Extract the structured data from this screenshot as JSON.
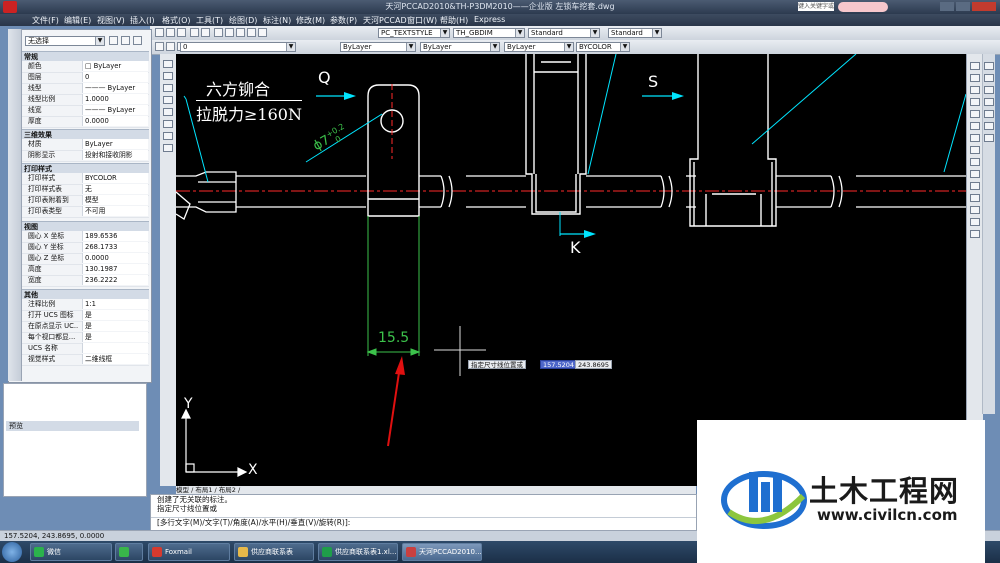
{
  "window": {
    "title": "天河PCCAD2010&TH-P3DM2010——企业版   左锁车挖套.dwg",
    "search_placeholder": "键入关键字或短语"
  },
  "menu": [
    "文件(F)",
    "编辑(E)",
    "视图(V)",
    "插入(I)",
    "格式(O)",
    "工具(T)",
    "绘图(D)",
    "标注(N)",
    "修改(M)",
    "参数(P)",
    "天河PCCAD",
    "窗口(W)",
    "帮助(H)",
    "Express"
  ],
  "toolbar": {
    "text_style": "PC_TEXTSTYLE",
    "dim_style": "TH_GBDIM",
    "table_style": "Standard",
    "multileader_style": "Standard",
    "layer": "0",
    "color": "ByLayer",
    "linetype": "ByLayer",
    "lineweight": "ByLayer",
    "plotstyle": "BYCOLOR"
  },
  "palette": {
    "selection": "无选择",
    "sections": [
      {
        "title": "常规",
        "rows": [
          [
            "颜色",
            "□ ByLayer"
          ],
          [
            "图层",
            "0"
          ],
          [
            "线型",
            "——— ByLayer"
          ],
          [
            "线型比例",
            "1.0000"
          ],
          [
            "线宽",
            "——— ByLayer"
          ],
          [
            "厚度",
            "0.0000"
          ]
        ]
      },
      {
        "title": "三维效果",
        "rows": [
          [
            "材质",
            "ByLayer"
          ],
          [
            "阴影显示",
            "投射和接收阴影"
          ]
        ]
      },
      {
        "title": "打印样式",
        "rows": [
          [
            "打印样式",
            "BYCOLOR"
          ],
          [
            "打印样式表",
            "无"
          ],
          [
            "打印表附着到",
            "模型"
          ],
          [
            "打印表类型",
            "不可用"
          ]
        ]
      },
      {
        "title": "视图",
        "rows": [
          [
            "圆心 X 坐标",
            "189.6536"
          ],
          [
            "圆心 Y 坐标",
            "268.1733"
          ],
          [
            "圆心 Z 坐标",
            "0.0000"
          ],
          [
            "高度",
            "130.1987"
          ],
          [
            "宽度",
            "236.2222"
          ]
        ]
      },
      {
        "title": "其他",
        "rows": [
          [
            "注释比例",
            "1:1"
          ],
          [
            "打开 UCS 图标",
            "是"
          ],
          [
            "在原点显示 UC...",
            "是"
          ],
          [
            "每个视口都显...",
            "是"
          ],
          [
            "UCS 名称",
            ""
          ],
          [
            "视觉样式",
            "二维线框"
          ]
        ]
      }
    ]
  },
  "preview_label": "预览",
  "drawing": {
    "annotation_line1": "六方铆合",
    "annotation_line2": "拉脱力≥160N",
    "label_q": "Q",
    "label_s": "S",
    "label_k": "K",
    "hole_dim": "ϕ7",
    "hole_tol": "+0.2",
    "hole_tol2": "0",
    "dimension": "15.5",
    "axis_x": "X",
    "axis_y": "Y",
    "prompt_text": "指定尺寸线位置或",
    "coord1": "157.5204",
    "coord2": "243.8695"
  },
  "layout_tabs": "模型  /  布局1  /  布局2  /",
  "command": {
    "line1": "创建了无关联的标注。",
    "line2": "指定尺寸线位置或",
    "line3": "[多行文字(M)/文字(T)/角度(A)/水平(H)/垂直(V)/旋转(R)]:"
  },
  "status": {
    "coords": "157.5204, 243.8695, 0.0000"
  },
  "taskbar": [
    {
      "label": "微信",
      "color": "#2bb24c"
    },
    {
      "label": "",
      "color": "#39b54a"
    },
    {
      "label": "Foxmail",
      "color": "#d63a2f"
    },
    {
      "label": "供应商联系表",
      "color": "#e7b94a"
    },
    {
      "label": "供应商联系表1.xl...",
      "color": "#1f9e4a"
    },
    {
      "label": "天河PCCAD2010...",
      "color": "#c94040"
    }
  ],
  "watermark": {
    "title": "土木工程网",
    "url": "www.civilcn.com"
  },
  "colors": {
    "accent_cyan": "#00e5ff",
    "dim_green": "#3cc24b",
    "red_arrow": "#e01010",
    "center_red": "#ff2a2a"
  }
}
